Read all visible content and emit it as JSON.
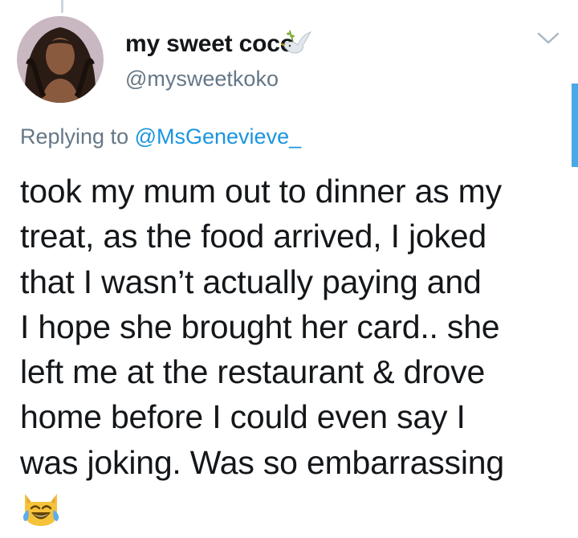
{
  "tweet": {
    "display_name": "my sweet coco",
    "display_name_emoji": "dove-with-olive-branch-icon",
    "handle": "@mysweetkoko",
    "reply_prefix": "Replying to",
    "reply_to": "@MsGenevieve_",
    "text_lines": [
      "took my mum out to dinner as my",
      "treat, as the food arrived, I joked",
      "that I wasn’t actually paying and",
      "I hope she brought her card.. she",
      "left me at the restaurant & drove",
      "home before I could even say I",
      "was joking. Was so embarrassing"
    ],
    "trailing_emoji": "cat-with-tears-of-joy-icon"
  },
  "colors": {
    "text": "#14171a",
    "secondary": "#657786",
    "link": "#1b95e0",
    "thread_line": "#ccd6dd",
    "scrollbar": "#4aa8e6"
  }
}
